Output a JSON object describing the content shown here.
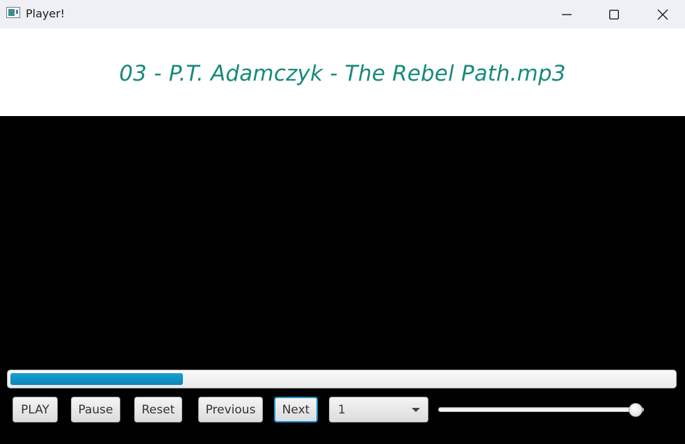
{
  "window": {
    "title": "Player!",
    "minimize_icon": "minimize-icon",
    "maximize_icon": "maximize-icon",
    "close_icon": "close-icon"
  },
  "header": {
    "song_title": "03 - P.T. Adamczyk - The Rebel Path.mp3",
    "title_color": "#178a7c"
  },
  "playback": {
    "progress_fraction": 0.26,
    "progress_color": "#0b94c8"
  },
  "controls": {
    "play_label": "PLAY",
    "pause_label": "Pause",
    "reset_label": "Reset",
    "previous_label": "Previous",
    "next_label": "Next",
    "speed_value": "1",
    "volume_fraction": 0.96
  }
}
